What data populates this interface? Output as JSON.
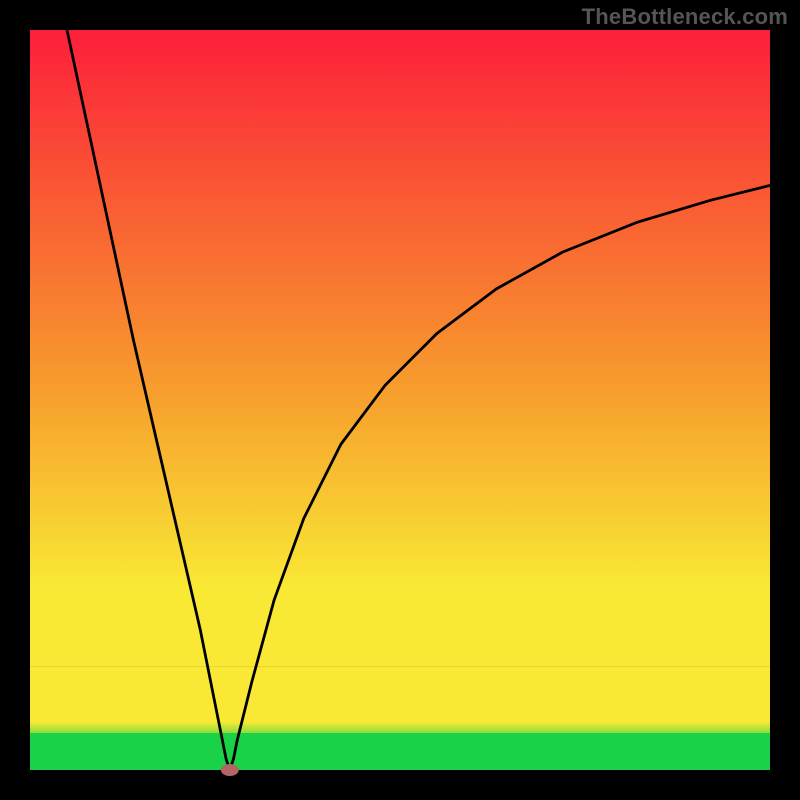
{
  "watermark": "TheBottleneck.com",
  "colors": {
    "frame": "#000000",
    "curve": "#000000",
    "dot": "#b36464",
    "green": "#19d247",
    "yellow": "#f9e934",
    "orange": "#f79a2d",
    "red": "#fc1f3a"
  },
  "chart_data": {
    "type": "line",
    "title": "",
    "xlabel": "",
    "ylabel": "",
    "xlim": [
      0,
      100
    ],
    "ylim": [
      0,
      100
    ],
    "bands": [
      {
        "name": "green",
        "ymin": 0,
        "ymax": 5
      },
      {
        "name": "yellow",
        "ymin": 5,
        "ymax": 14
      }
    ],
    "gradient_stops": [
      {
        "pos": 0.0,
        "color": "#fc1f3a"
      },
      {
        "pos": 0.55,
        "color": "#f79a2d"
      },
      {
        "pos": 0.88,
        "color": "#f9e934"
      },
      {
        "pos": 1.0,
        "color": "#f9e934"
      }
    ],
    "minimum_point": {
      "x": 27,
      "y": 0
    },
    "series": [
      {
        "name": "left-branch",
        "x": [
          5,
          8,
          11,
          14,
          17,
          20,
          23,
          25,
          26,
          26.5,
          27
        ],
        "values": [
          100,
          86,
          72,
          58,
          45,
          32,
          19,
          9,
          4,
          1.5,
          0
        ]
      },
      {
        "name": "right-branch",
        "x": [
          27,
          27.5,
          28,
          30,
          33,
          37,
          42,
          48,
          55,
          63,
          72,
          82,
          92,
          100
        ],
        "values": [
          0,
          1.5,
          4,
          12,
          23,
          34,
          44,
          52,
          59,
          65,
          70,
          74,
          77,
          79
        ]
      }
    ],
    "notes": "V-shaped bottleneck curve. Thin green band at bottom (≈0–5%), yellow band above it (≈5–14%), then a continuous vertical gradient from yellow through orange to red toward the top. The curve has a sharp minimum near x≈27 marked by a small reddish dot; left branch is nearly straight, right branch rises concavely and flattens toward the top-right."
  }
}
